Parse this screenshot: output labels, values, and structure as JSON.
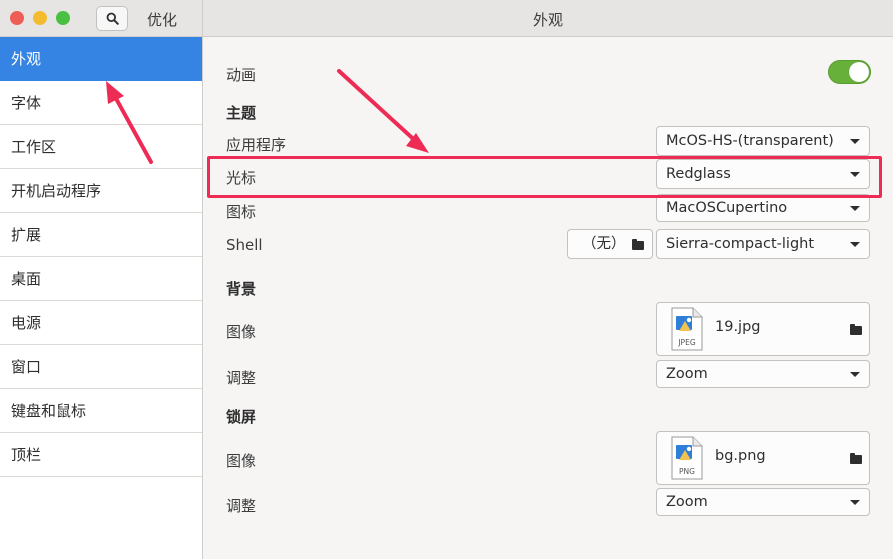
{
  "window": {
    "app_title": "优化",
    "page_title": "外观"
  },
  "sidebar": {
    "items": [
      {
        "label": "外观",
        "active": true
      },
      {
        "label": "字体"
      },
      {
        "label": "工作区"
      },
      {
        "label": "开机启动程序"
      },
      {
        "label": "扩展"
      },
      {
        "label": "桌面"
      },
      {
        "label": "电源"
      },
      {
        "label": "窗口"
      },
      {
        "label": "键盘和鼠标"
      },
      {
        "label": "顶栏"
      }
    ]
  },
  "main": {
    "animation": {
      "label": "动画",
      "enabled": true
    },
    "themes": {
      "heading": "主题",
      "applications": {
        "label": "应用程序",
        "value": "McOS-HS-(transparent)"
      },
      "cursor": {
        "label": "光标",
        "value": "Redglass"
      },
      "icons": {
        "label": "图标",
        "value": "MacOSCupertino"
      },
      "shell": {
        "label": "Shell",
        "file_value": "（无）",
        "value": "Sierra-compact-light"
      }
    },
    "background": {
      "heading": "背景",
      "image": {
        "label": "图像",
        "file": "19.jpg",
        "file_type": "JPEG"
      },
      "adjust": {
        "label": "调整",
        "value": "Zoom"
      }
    },
    "lockscreen": {
      "heading": "锁屏",
      "image": {
        "label": "图像",
        "file": "bg.png",
        "file_type": "PNG"
      },
      "adjust": {
        "label": "调整",
        "value": "Zoom"
      }
    }
  },
  "colors": {
    "accent": "#3584e4",
    "toggle_on": "#67b03a",
    "annotation": "#ee2b55"
  }
}
